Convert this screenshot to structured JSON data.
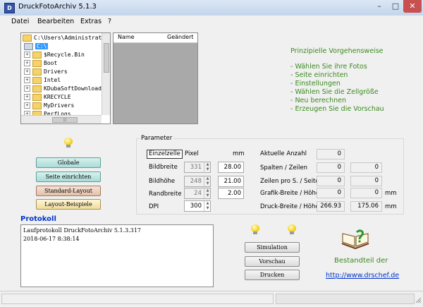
{
  "window": {
    "app_icon_letter": "D",
    "title": "DruckFotoArchiv  5.1.3",
    "min": "–",
    "max": "□",
    "close": "✕"
  },
  "menu": [
    "Datei",
    "Bearbeiten",
    "Extras",
    "?"
  ],
  "tree": {
    "root": "C:\\Users\\Administrator\\",
    "drive": "C:\\",
    "folders": [
      "$Recycle.Bin",
      "Boot",
      "Drivers",
      "Intel",
      "KDubaSoftDownloads",
      "KRECYCLE",
      "MyDrivers",
      "PerfLogs"
    ],
    "hscroll_grip": "|||"
  },
  "file_list": {
    "columns": [
      "Name",
      "Geändert"
    ]
  },
  "guide": {
    "title": "Prinzipielle Vorgehensweise",
    "steps": [
      "- Wählen Sie ihre Fotos",
      "- Seite einrichten",
      "- Einstellungen",
      "- Wählen Sie die Zellgröße",
      "- Neu berechnen",
      "- Erzeugen Sie die Vorschau"
    ]
  },
  "left_buttons": {
    "globale": "Globale",
    "seite": "Seite einrichten",
    "standard": "Standard-Layout",
    "beispiele": "Layout-Beispiele"
  },
  "params": {
    "group_label": "Parameter",
    "einzelzelle": "Einzelzelle",
    "col_pixel": "Pixel",
    "col_mm": "mm",
    "rows": [
      {
        "label": "Bildbreite",
        "pixel": "331",
        "mm": "28.00"
      },
      {
        "label": "Bildhöhe",
        "pixel": "248",
        "mm": "21.00"
      },
      {
        "label": "Randbreite",
        "pixel": "24",
        "mm": "2.00"
      }
    ],
    "dpi_label": "DPI",
    "dpi": "300",
    "right": [
      {
        "label": "Aktuelle Anzahl",
        "v1": "0",
        "v2": "",
        "unit": ""
      },
      {
        "label": "Spalten / Zeilen",
        "v1": "0",
        "v2": "0",
        "unit": ""
      },
      {
        "label": "Zeilen pro S. / Seiten",
        "v1": "0",
        "v2": "0",
        "unit": ""
      },
      {
        "label": "Grafik-Breite / Höhe",
        "v1": "0",
        "v2": "0",
        "unit": "mm"
      },
      {
        "label": "Druck-Breite / Höhe",
        "v1": "266.93",
        "v2": "175.06",
        "unit": "mm"
      }
    ]
  },
  "protokoll": {
    "title": "Protokoll",
    "lines": [
      "Laufprotokoll DruckFotoArchiv 5.1.3.317",
      "2018-06-17 8:38:14"
    ]
  },
  "actions": {
    "simulation": "Simulation",
    "vorschau": "Vorschau",
    "drucken": "Drucken"
  },
  "footer": {
    "bestandteil": "Bestandteil der",
    "url": "http://www.drschef.de"
  },
  "colors": {
    "accent_blue": "#0033cc",
    "guide_green": "#3a8a1e",
    "selection": "#3399ff"
  }
}
